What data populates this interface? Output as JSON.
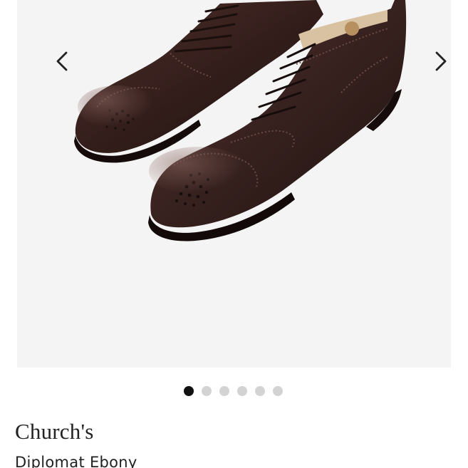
{
  "gallery": {
    "image_alt": "Brown brogue oxford shoes",
    "prev_icon": "chevron-left-icon",
    "next_icon": "chevron-right-icon",
    "slide_count": 6,
    "active_slide": 1
  },
  "product": {
    "brand": "Church's",
    "name": "Diplomat Ebony"
  },
  "colors": {
    "gallery_bg": "#f4f4f4",
    "dot_active": "#111111",
    "dot_inactive": "#d3d3d3",
    "leather": "#3a2320"
  }
}
